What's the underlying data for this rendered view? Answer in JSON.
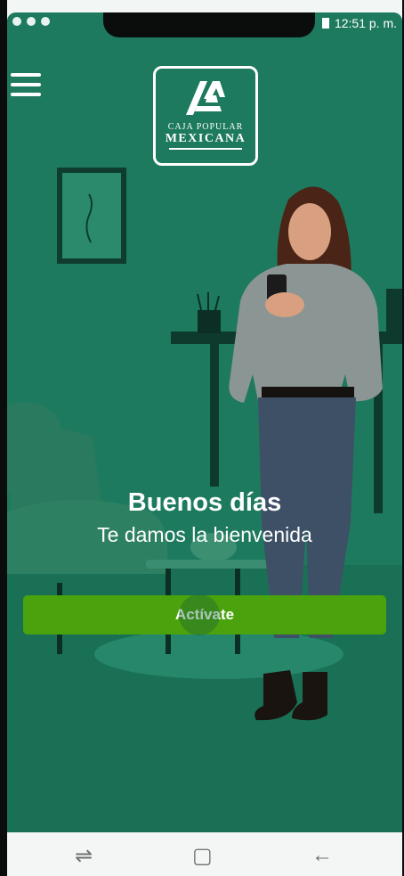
{
  "status_bar": {
    "time": "12:51 p. m."
  },
  "logo": {
    "line1": "CAJA POPULAR",
    "line2": "MEXICANA"
  },
  "greeting": {
    "title": "Buenos días",
    "subtitle": "Te damos la bienvenida"
  },
  "activate_button": {
    "label": "Actívate"
  },
  "nav_bar": {
    "recent_icon": "recent-apps-icon",
    "home_icon": "home-icon",
    "back_icon": "back-icon"
  },
  "colors": {
    "background": "#1e7a5e",
    "button": "#4aa30c",
    "text": "#ffffff"
  }
}
